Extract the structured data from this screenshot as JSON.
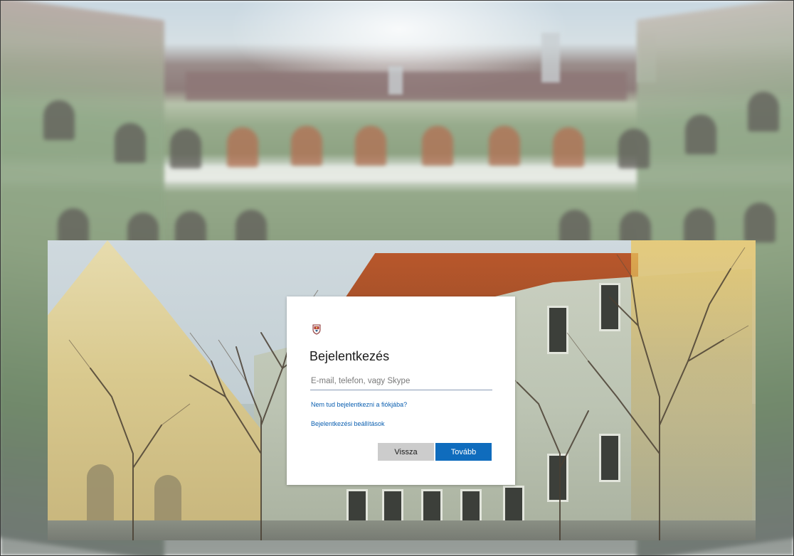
{
  "signin": {
    "logo_icon": "university-crest-icon",
    "title": "Bejelentkezés",
    "email_placeholder": "E-mail, telefon, vagy Skype",
    "email_value": "",
    "cant_access_link": "Nem tud bejelentkezni a fiókjába?",
    "signin_options_link": "Bejelentkezési beállítások",
    "back_button": "Vissza",
    "next_button": "Tovább"
  },
  "colors": {
    "accent": "#0f6cbd",
    "link": "#0b5fb0",
    "back_button_bg": "#cccccc"
  }
}
